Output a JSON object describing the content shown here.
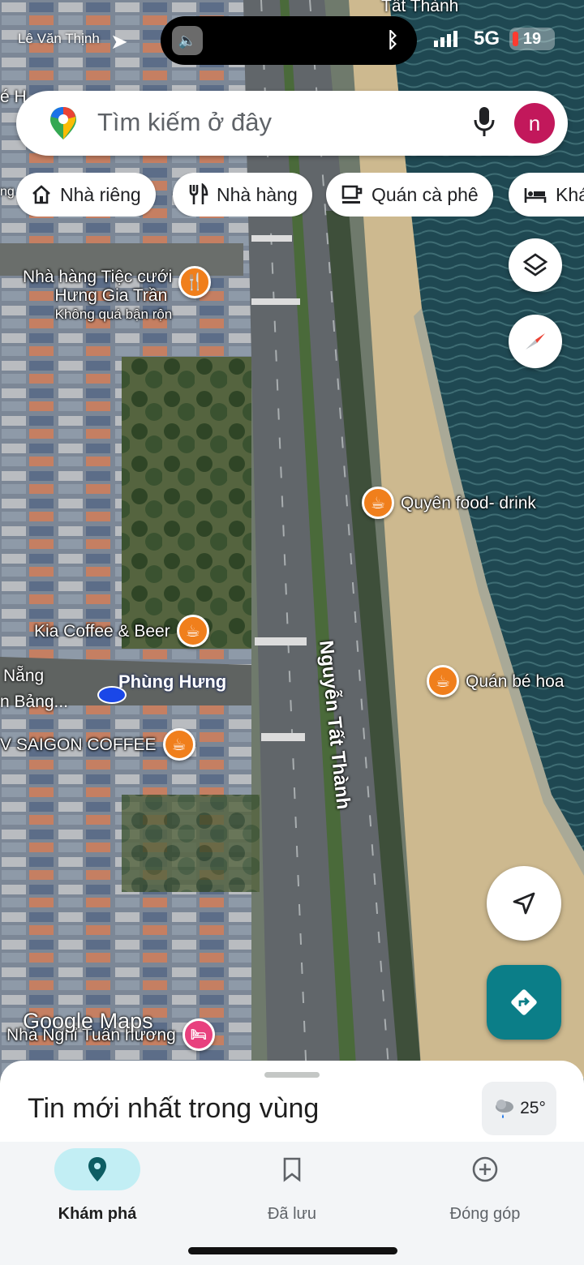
{
  "status_bar": {
    "top_street": "Lê Văn Thịnh",
    "network": "5G",
    "battery": "19"
  },
  "search": {
    "placeholder": "Tìm kiếm ở đây",
    "avatar_letter": "n"
  },
  "chips": [
    {
      "label": "Nhà riêng",
      "icon": "home-icon"
    },
    {
      "label": "Nhà hàng",
      "icon": "restaurant-icon"
    },
    {
      "label": "Quán cà phê",
      "icon": "cafe-icon"
    },
    {
      "label": "Khá",
      "icon": "hotel-icon"
    }
  ],
  "map": {
    "places": {
      "wedding": {
        "line1": "Nhà hàng Tiệc cưới",
        "line2": "Hưng Gia Trần",
        "sub": "Không quá bận rộn"
      },
      "quyen": "Quyên food- drink",
      "kia": "Kia Coffee & Beer",
      "be_hoa": "Quán bé hoa",
      "saigon": "V SAIGON COFFEE",
      "nha_nghi": "Nhà Nghỉ Tuấn hương"
    },
    "nang_line1": "Nẵng",
    "nang_line2": "n Bảng...",
    "phung_hung": "Phùng Hưng",
    "road_main": "Nguyễn Tất Thành",
    "road_top": "Tất Thành",
    "top_left_partial": "é H",
    "left_partial": "ng",
    "watermark": "Google Maps"
  },
  "sheet": {
    "title": "Tin mới nhất trong vùng",
    "temperature": "25°"
  },
  "bottom_nav": [
    {
      "label": "Khám phá",
      "active": true
    },
    {
      "label": "Đã lưu",
      "active": false
    },
    {
      "label": "Đóng góp",
      "active": false
    }
  ],
  "colors": {
    "accent": "#0b7e88",
    "pin_orange": "#f07f1c",
    "pin_pink": "#e8407e",
    "avatar": "#c2185b",
    "active_nav": "#c2eef4"
  }
}
